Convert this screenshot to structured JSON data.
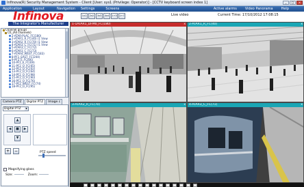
{
  "window": {
    "title": "Infinova(R) Security Management System - Client [User: sys1 (Privilege: Operator)] - [CCTV keyboard screen index 1]",
    "min_label": "_",
    "max_label": "□",
    "close_label": "×"
  },
  "menu": {
    "items": [
      "Application",
      "Layout",
      "Navigation",
      "Settings",
      "Screens"
    ],
    "active_alarms": "Active alarms",
    "video_panorama": "Video Panorama",
    "help": "Help"
  },
  "logo": {
    "brand": "Infinova",
    "tagline": "The Integrator's Manufacturer"
  },
  "toolbar": {
    "buttons": [
      "1x1",
      "2x2",
      "3x3",
      "4x4",
      "1+5",
      "1+7"
    ],
    "live_label": "Live video",
    "current_time": "Current Time: 17/10/2012 17:08:15"
  },
  "tree": {
    "root": "Channel groups",
    "group": "Ctl_(All channels)",
    "channels": [
      "2-ATAR-PLAC_FC(180)",
      "2-ATAR1_R_FC(40) (1 View",
      "3-ATAR2_R_FC(70) (1 View",
      "4-ATAR3_C_FC(71) (1 View",
      "5-ATAR3_C_FC(72)",
      "6-ATAR3_C_FC(73)",
      "7-ATAR4_WEST_FC(183)",
      "8-PF1_EAST_FC(204)",
      "9-PF2_E_FC(66)",
      "10-PF2_E_FC(69)",
      "11-PF2_O_FC(65)",
      "12-PF2_O_FC(02)",
      "13-PF2_O_FC(64)",
      "14-PF2_O_FC(98)",
      "15-PF2_O_FC(90)",
      "16-PF2_O_FC(76)",
      "17-PF2_WEST_FC(74)",
      "18-PF2_O_FC(95)"
    ]
  },
  "tabs": [
    "Camera PTZ",
    "Digital PTZ",
    "Image c"
  ],
  "ptz": {
    "selected_mode": "Digital PTZ",
    "speed_label": "PTZ speed",
    "magnifying_label": "Magnifying glass",
    "size_label": "Size:",
    "zoom_label": "Zoom:",
    "up": "▲",
    "down": "▼",
    "left": "◀",
    "right": "▶",
    "center": "■",
    "zoom_in": "+",
    "zoom_out": "−"
  },
  "video_tiles": [
    {
      "label": "1-1ATAR1_DFM0_FC(180)",
      "header_color": "#c62d2d"
    },
    {
      "label": "2-ATAR1_R_FC(40)",
      "header_color": "#1aa6b5"
    },
    {
      "label": "3-ATAR2_R_FC(70)",
      "header_color": "#1aa6b5"
    },
    {
      "label": "4-ATAR3_C_FC(71)",
      "header_color": "#1aa6b5"
    }
  ],
  "tile_close": "x",
  "bottom_strip": {
    "thumbnails": 17
  }
}
